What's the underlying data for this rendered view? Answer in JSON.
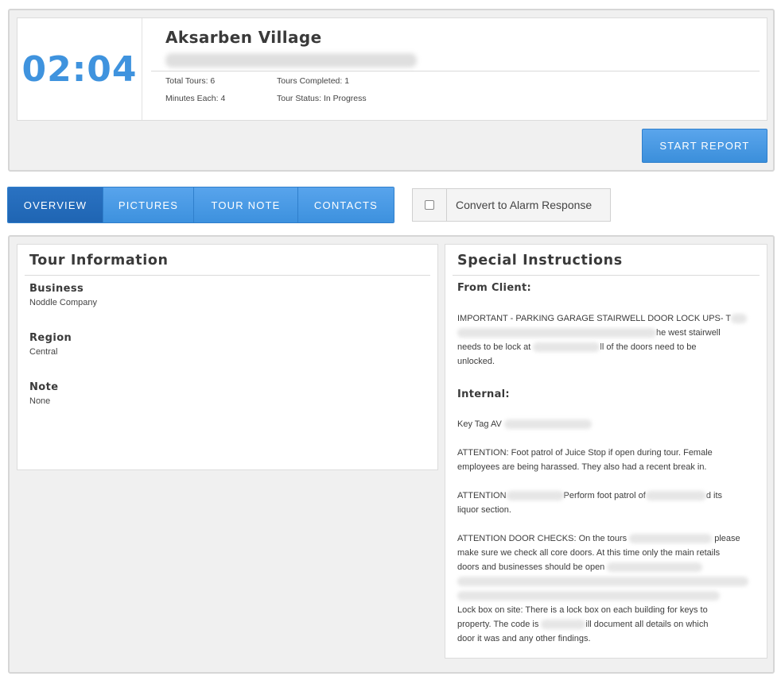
{
  "header": {
    "timer": "02:04",
    "site_name": "Aksarben Village",
    "stats": {
      "total_tours": "Total Tours: 6",
      "minutes_each": "Minutes Each: 4",
      "tours_completed": "Tours Completed: 1",
      "tour_status": "Tour Status: In Progress"
    },
    "start_report_label": "START REPORT"
  },
  "tabs": [
    {
      "label": "OVERVIEW",
      "active": true
    },
    {
      "label": "PICTURES",
      "active": false
    },
    {
      "label": "TOUR NOTE",
      "active": false
    },
    {
      "label": "CONTACTS",
      "active": false
    }
  ],
  "alarm_toggle": {
    "label": "Convert to Alarm Response",
    "checked": false
  },
  "tour_info": {
    "title": "Tour Information",
    "fields": [
      {
        "label": "Business",
        "value": "Noddle Company"
      },
      {
        "label": "Region",
        "value": "Central"
      },
      {
        "label": "Note",
        "value": "None"
      }
    ]
  },
  "special_instructions": {
    "title": "Special Instructions",
    "from_client_heading": "From Client:",
    "client_text_1a": "IMPORTANT - PARKING GARAGE STAIRWELL DOOR LOCK UPS- T",
    "client_text_1b": "he west stairwell",
    "client_text_1c": "needs to be lock at",
    "client_text_1d": "ll of the doors need to be",
    "client_text_1e": "unlocked.",
    "internal_heading": "Internal:",
    "key_tag": "Key Tag AV",
    "attention_1": "ATTENTION: Foot patrol of Juice Stop if open during tour. Female employees are being harassed. They also had a recent break in.",
    "attention_2a": "ATTENTION",
    "attention_2b": "Perform foot patrol of",
    "attention_2c": "d its",
    "attention_2d": "liquor section.",
    "attention_3a": "ATTENTION DOOR CHECKS: On the tours",
    "attention_3b": "please",
    "attention_3c": "make sure we check all core doors. At this time only the main retails",
    "attention_3d": "doors and businesses should be open",
    "lockbox_1": "Lock box on site: There is a lock box on each building for keys to",
    "lockbox_2a": "property. The code is",
    "lockbox_2b": "ill document all details on which",
    "lockbox_3": "door it was and any other findings."
  }
}
